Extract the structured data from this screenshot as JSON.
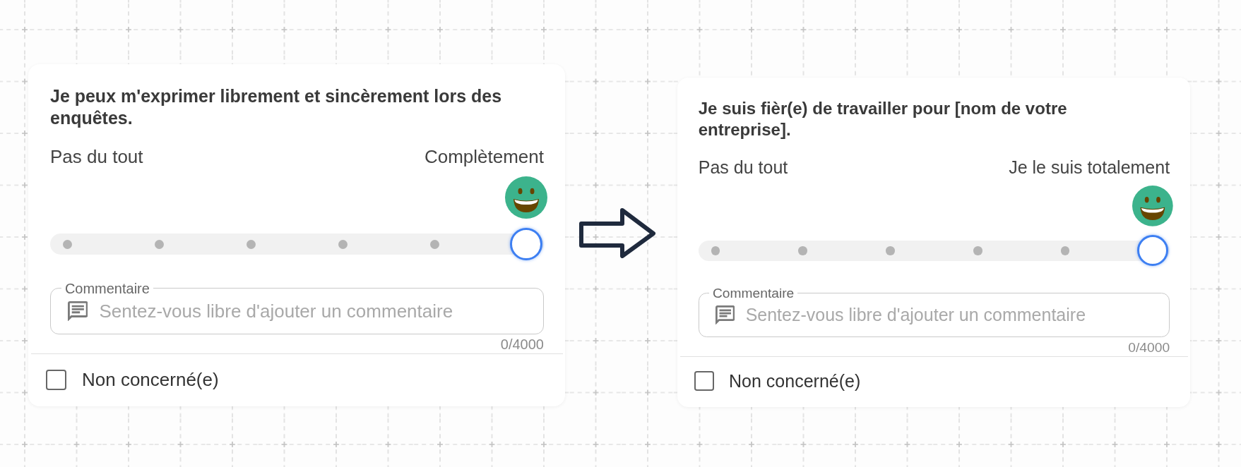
{
  "cards": [
    {
      "question": "Je peux m'exprimer librement et sincèrement lors des enquêtes.",
      "scale": {
        "min_label": "Pas du tout",
        "max_label": "Complètement",
        "level": 1
      },
      "comment": {
        "label": "Commentaire",
        "placeholder": "Sentez-vous libre d'ajouter un commentaire",
        "counter": "0/4000"
      },
      "not_applicable": {
        "label": "Non concerné(e)",
        "checked": false
      }
    },
    {
      "question": "Je suis fièr(e) de travailler pour [nom de votre entreprise].",
      "scale": {
        "min_label": "Pas du tout",
        "max_label": "Je le suis totalement",
        "level": 1
      },
      "comment": {
        "label": "Commentaire",
        "placeholder": "Sentez-vous libre d'ajouter un commentaire",
        "counter": "0/4000"
      },
      "not_applicable": {
        "label": "Non concerné(e)",
        "checked": false
      }
    }
  ]
}
